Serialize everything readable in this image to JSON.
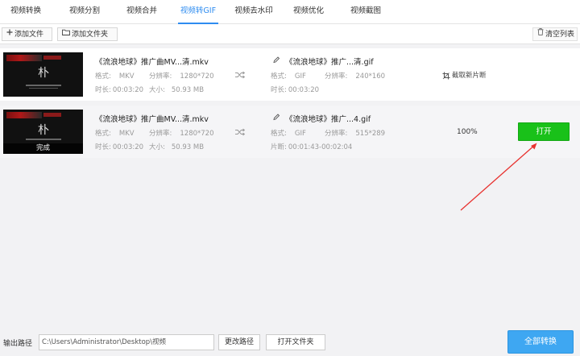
{
  "tabs": [
    {
      "label": "视频转换"
    },
    {
      "label": "视频分割"
    },
    {
      "label": "视频合并"
    },
    {
      "label": "视频转GIF",
      "active": true
    },
    {
      "label": "视频去水印"
    },
    {
      "label": "视频优化"
    },
    {
      "label": "视频截图"
    }
  ],
  "toolbar": {
    "add_file": "添加文件",
    "add_folder": "添加文件夹",
    "clear_list": "清空列表"
  },
  "labels": {
    "format": "格式:",
    "resolution": "分辨率:",
    "duration": "时长:",
    "size": "大小:",
    "clip": "片断:"
  },
  "rows": [
    {
      "thumb_status": "",
      "src_name": "《流浪地球》推广曲MV...清.mkv",
      "src_format": "MKV",
      "src_resolution": "1280*720",
      "src_duration": "00:03:20",
      "src_size": "50.93 MB",
      "out_name": "《流浪地球》推广...清.gif",
      "out_format": "GIF",
      "out_resolution": "240*160",
      "out_time_label": "时长:",
      "out_time": "00:03:20",
      "action_label": "截取新片断"
    },
    {
      "thumb_status": "完成",
      "src_name": "《流浪地球》推广曲MV...清.mkv",
      "src_format": "MKV",
      "src_resolution": "1280*720",
      "src_duration": "00:03:20",
      "src_size": "50.93 MB",
      "out_name": "《流浪地球》推广...4.gif",
      "out_format": "GIF",
      "out_resolution": "515*289",
      "out_time_label": "片断:",
      "out_time": "00:01:43-00:02:04",
      "progress": "100%",
      "open_label": "打开"
    }
  ],
  "bottom": {
    "output_label": "输出路径",
    "output_path": "C:\\Users\\Administrator\\Desktop\\视频",
    "change_path": "更改路径",
    "open_folder": "打开文件夹",
    "convert_all": "全部转换"
  },
  "colors": {
    "accent": "#2e8cf0",
    "open_button": "#19c119",
    "convert_button": "#3ea7f2",
    "annotation_arrow": "#e8322f"
  },
  "icons": {
    "add_file": "plus-icon",
    "add_folder": "folder-icon",
    "clear_list": "trash-icon",
    "convert": "shuffle-icon",
    "rename": "pencil-icon",
    "clip": "crop-icon"
  }
}
